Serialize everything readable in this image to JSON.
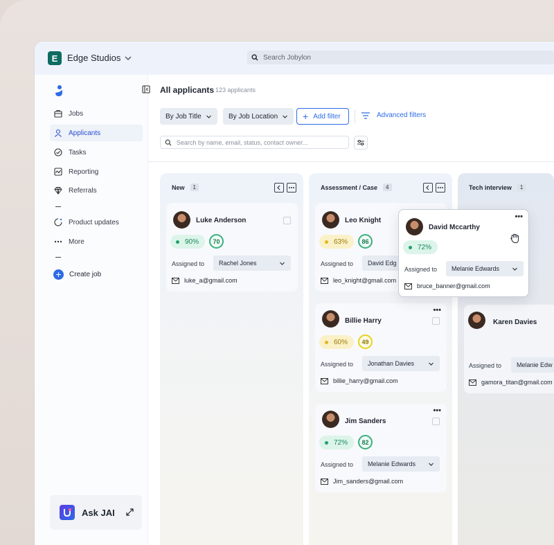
{
  "workspace": {
    "initial": "E",
    "name": "Edge Studios"
  },
  "top_search": {
    "placeholder": "Search Jobylon"
  },
  "sidebar": {
    "items": [
      {
        "label": "Jobs",
        "icon": "briefcase-icon"
      },
      {
        "label": "Applicants",
        "icon": "person-icon",
        "active": true
      },
      {
        "label": "Tasks",
        "icon": "check-circle-icon"
      },
      {
        "label": "Reporting",
        "icon": "chart-icon"
      },
      {
        "label": "Referrals",
        "icon": "diamond-icon"
      },
      {
        "label": "Product updates",
        "icon": "sparkle-icon"
      },
      {
        "label": "More",
        "icon": "more-dots-icon"
      }
    ],
    "create_job": "Create job",
    "ask_jai": "Ask JAI"
  },
  "page": {
    "title": "All applicants",
    "count": "123 applicants",
    "filters": {
      "job_title": "By Job Title",
      "job_location": "By Job Location",
      "add_filter": "Add filter",
      "advanced": "Advanced filters"
    },
    "search_placeholder": "Search by name, email, status, contact owner..."
  },
  "assigned_label": "Assigned to",
  "columns": [
    {
      "title": "New",
      "count": "1",
      "cards": [
        {
          "name": "Luke Anderson",
          "match": "90%",
          "score": "70",
          "assignee": "Rachel Jones",
          "email": "luke_a@gmail.com"
        }
      ]
    },
    {
      "title": "Assessment / Case",
      "count": "4",
      "cards": [
        {
          "name": "Leo Knight",
          "match": "63%",
          "score": "86",
          "assignee": "David Edg",
          "email": "leo_knight@gmail.com"
        },
        {
          "name": "Billie Harry",
          "match": "60%",
          "score": "49",
          "assignee": "Jonathan Davies",
          "email": "billie_harry@gmail.com"
        },
        {
          "name": "Jim Sanders",
          "match": "72%",
          "score": "82",
          "assignee": "Melanie Edwards",
          "email": "Jim_sanders@gmail.com"
        }
      ]
    },
    {
      "title": "Tech interview",
      "count": "1",
      "cards": [
        {
          "name": "Karen Davies",
          "assignee": "Melanie Edw",
          "email": "gamora_titan@gmail.com"
        }
      ]
    }
  ],
  "dragging_card": {
    "name": "David Mccarthy",
    "match": "72%",
    "assignee": "Melanie Edwards",
    "email": "bruce_banner@gmail.com"
  },
  "colors": {
    "accent": "#2e6be6",
    "brand": "#0e6b62",
    "green": "#22a06b",
    "yellow": "#e0b81c"
  }
}
